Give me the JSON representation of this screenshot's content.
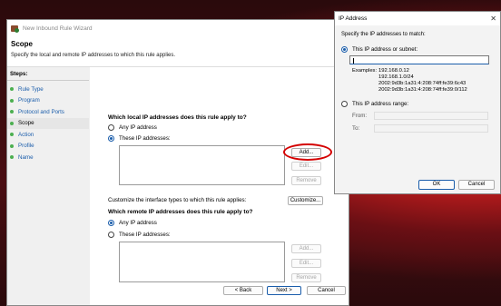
{
  "wizard": {
    "title": "New Inbound Rule Wizard",
    "header_title": "Scope",
    "header_subtitle": "Specify the local and remote IP addresses to which this rule applies.",
    "steps_label": "Steps:",
    "steps": [
      {
        "label": "Rule Type"
      },
      {
        "label": "Program"
      },
      {
        "label": "Protocol and Ports"
      },
      {
        "label": "Scope"
      },
      {
        "label": "Action"
      },
      {
        "label": "Profile"
      },
      {
        "label": "Name"
      }
    ],
    "local_question": "Which local IP addresses does this rule apply to?",
    "remote_question": "Which remote IP addresses does this rule apply to?",
    "any_ip": "Any IP address",
    "these_ips": "These IP addresses:",
    "add": "Add...",
    "edit": "Edit...",
    "remove": "Remove",
    "customize_text": "Customize the interface types to which this rule applies:",
    "customize_button": "Customize...",
    "back": "< Back",
    "next": "Next >",
    "cancel": "Cancel",
    "local_selected": "these",
    "remote_selected": "any"
  },
  "ip_dialog": {
    "title": "IP Address",
    "prompt": "Specify the IP addresses to match:",
    "option_single": "This IP address or subnet:",
    "input_value": "",
    "examples_label": "Examples:",
    "examples": [
      "192.168.0.12",
      "192.168.1.0/24",
      "2002:9d3b:1a31:4:208:74ff:fe39:6c43",
      "2002:9d3b:1a31:4:208:74ff:fe39:0/112"
    ],
    "option_range": "This IP address range:",
    "from_label": "From:",
    "to_label": "To:",
    "ok": "OK",
    "cancel": "Cancel"
  },
  "colors": {
    "accent": "#1a5dab",
    "highlight_oval": "#d40000"
  }
}
